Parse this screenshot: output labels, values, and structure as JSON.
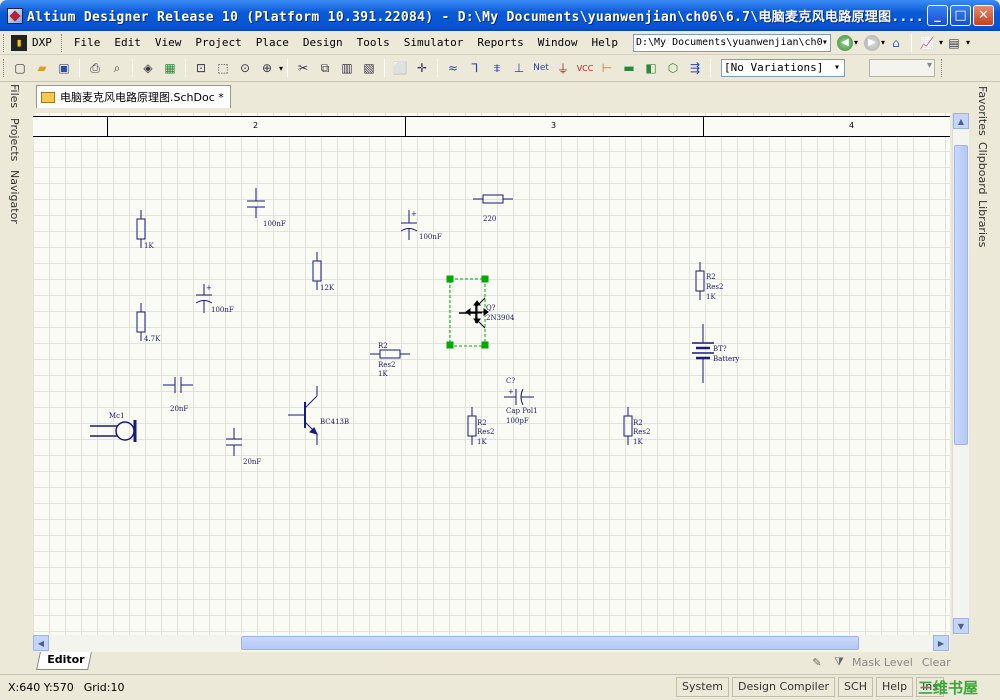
{
  "window": {
    "title": "Altium Designer Release 10 (Platform 10.391.22084) - D:\\My Documents\\yuanwenjian\\ch06\\6.7\\电脑麦克风电路原理图....",
    "minimize": "_",
    "maximize": "□",
    "close": "✕"
  },
  "menu": {
    "dxp": "DXP",
    "items": [
      "File",
      "Edit",
      "View",
      "Project",
      "Place",
      "Design",
      "Tools",
      "Simulator",
      "Reports",
      "Window",
      "Help"
    ],
    "path": "D:\\My Documents\\yuanwenjian\\ch0"
  },
  "toolbar": {
    "variations": "[No Variations]"
  },
  "left_panel": {
    "tabs": [
      "Files",
      "Projects",
      "Navigator"
    ]
  },
  "right_panel": {
    "tabs": [
      "Favorites",
      "Clipboard",
      "Libraries"
    ]
  },
  "document": {
    "tab_label": "电脑麦克风电路原理图.SchDoc *"
  },
  "sheet": {
    "zone_numbers": [
      "2",
      "3",
      "4"
    ]
  },
  "components": {
    "r_1k_a": "1K",
    "c_100nf_a": "100nF",
    "c_100nf_b": "100nF",
    "r_220": "220",
    "r_12k": "12K",
    "r_47k": "4.7K",
    "c_100nf_c": "100nF",
    "q_designator": "Q?",
    "q_part": "2N3904",
    "r2_desig_a": "R2",
    "r2_val_a": "Res2",
    "r2_k_a": "1K",
    "bt_designator": "BT?",
    "bt_part": "Battery",
    "r2_desig_b": "R2",
    "r2_val_b": "Res2",
    "r2_k_b": "1K",
    "c_20nf_a": "20nF",
    "mic_label": "Mc1",
    "bc_part": "BC413B",
    "c_20nf_b": "20nF",
    "c7_desig": "C?",
    "c7_part": "Cap Pol1",
    "c7_val": "100pF",
    "r2_desig_c": "R2",
    "r2_val_c": "Res2",
    "r2_k_c": "1K",
    "r2_desig_d": "R2",
    "r2_val_d": "Res2",
    "r2_k_d": "1K"
  },
  "editor": {
    "tab": "Editor",
    "mask_level": "Mask Level",
    "clear": "Clear"
  },
  "status": {
    "coords": "X:640 Y:570",
    "grid": "Grid:10",
    "buttons": [
      "System",
      "Design Compiler",
      "SCH",
      "Help",
      "Ins"
    ],
    "watermark": "三维书屋"
  },
  "colors": {
    "schematic_ink": "#1a1a7a",
    "selection": "#00aa00",
    "titlebar": "#0A5AD8"
  }
}
